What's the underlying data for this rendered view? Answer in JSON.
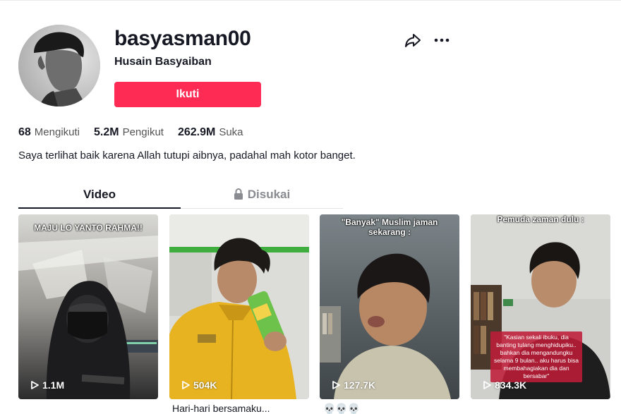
{
  "profile": {
    "username": "basyasman00",
    "nickname": "Husain Basyaiban",
    "follow_label": "Ikuti",
    "avatar_icon": "avatar-photo",
    "share_icon": "share-arrow-icon",
    "more_icon": "more-dots-icon",
    "accent_color": "#fe2c55"
  },
  "stats": {
    "following_count": "68",
    "following_label": "Mengikuti",
    "followers_count": "5.2M",
    "followers_label": "Pengikut",
    "likes_count": "262.9M",
    "likes_label": "Suka"
  },
  "bio": "Saya terlihat baik karena Allah tutupi aibnya, padahal mah kotor banget.",
  "tabs": {
    "videos_label": "Video",
    "liked_label": "Disukai"
  },
  "videos": [
    {
      "caption": "MAJU LO YANTO RAHMA!!",
      "views": "1.1M",
      "description": ""
    },
    {
      "caption": "",
      "views": "504K",
      "description": "Hari-hari bersamaku..."
    },
    {
      "caption": "\"Banyak\" Muslim jaman sekarang :",
      "views": "127.7K",
      "description": "💀💀💀"
    },
    {
      "caption": "Pemuda zaman dulu :",
      "views": "834.3K",
      "description": "",
      "overlay": "\"Kasian sekali ibuku, dia banting tulang menghidupiku.. bahkan dia mengandungku selama 9 bulan.. aku harus bisa membahagiakan dia dan bersabar\""
    }
  ]
}
